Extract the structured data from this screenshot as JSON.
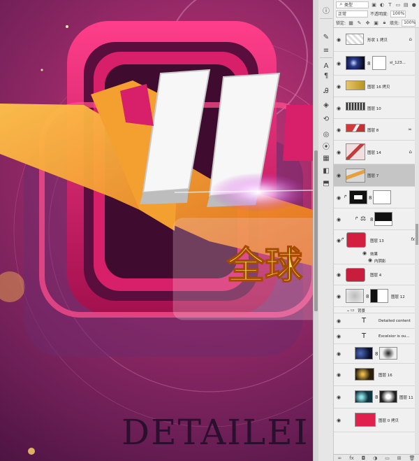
{
  "canvas": {
    "headline_big": "11",
    "headline_cn": "全球",
    "detailed_text": "DETAILEI"
  },
  "panel": {
    "filter_kind": "类型",
    "blend_mode": "正常",
    "opacity_label": "不透明度:",
    "opacity_value": "100%",
    "lock_label": "锁定:",
    "fill_label": "填充:",
    "fill_value": "100%"
  },
  "layers": [
    {
      "name": "形状 1 拷贝",
      "badge": "lock"
    },
    {
      "name": "sl_123...",
      "badge": ""
    },
    {
      "name": "图层 16 拷贝",
      "badge": ""
    },
    {
      "name": "图层 10",
      "badge": ""
    },
    {
      "name": "图层 8",
      "badge": "link"
    },
    {
      "name": "图层 14",
      "badge": "lock"
    },
    {
      "name": "图层 7",
      "badge": ""
    },
    {
      "name": "",
      "badge": ""
    },
    {
      "name": "",
      "badge": ""
    },
    {
      "name": "图层 13",
      "badge": "fx"
    },
    {
      "name": "效果",
      "badge": ""
    },
    {
      "name": "内阴影",
      "badge": ""
    },
    {
      "name": "图层 4",
      "badge": ""
    },
    {
      "name": "图层 12",
      "badge": ""
    },
    {
      "name": "背景",
      "badge": ""
    },
    {
      "name": "Detailed content",
      "badge": ""
    },
    {
      "name": "Excelsior is ou...",
      "badge": ""
    },
    {
      "name": "",
      "badge": ""
    },
    {
      "name": "图层 16",
      "badge": ""
    },
    {
      "name": "图层 11",
      "badge": ""
    },
    {
      "name": "图层 0 拷贝",
      "badge": ""
    }
  ],
  "icons": {
    "text_layer_glyph": "T",
    "fx_glyph": "fx"
  }
}
